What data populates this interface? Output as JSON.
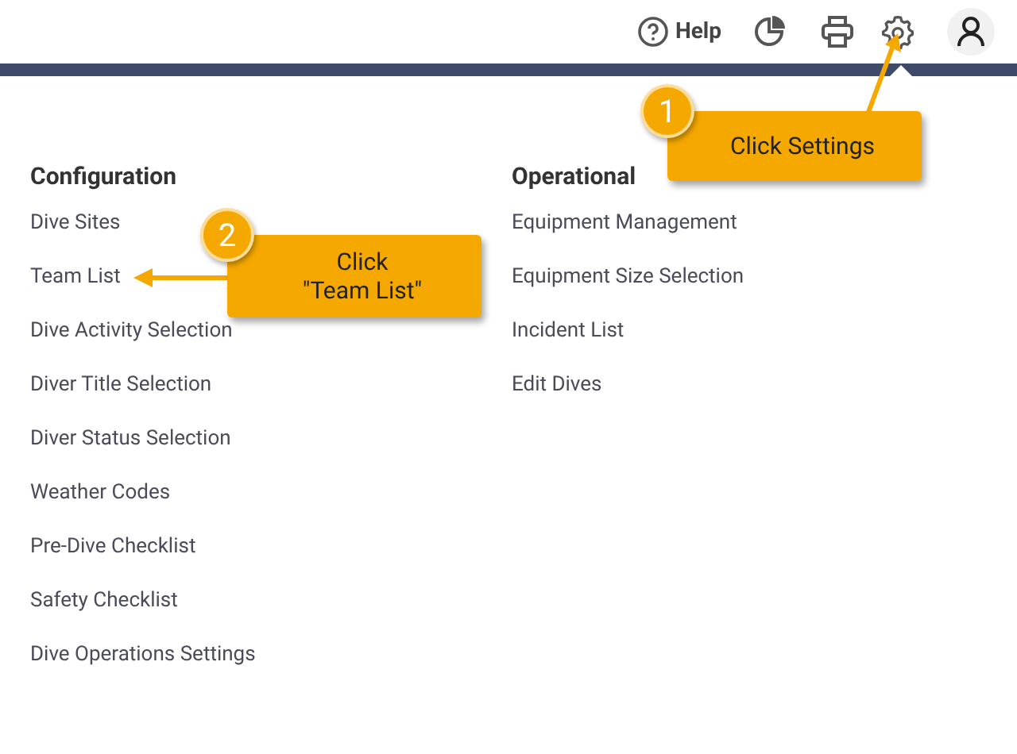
{
  "header": {
    "help_label": "Help"
  },
  "columns": [
    {
      "heading": "Configuration",
      "items": [
        "Dive Sites",
        "Team List",
        "Dive Activity Selection",
        "Diver Title Selection",
        "Diver Status Selection",
        "Weather Codes",
        "Pre-Dive Checklist",
        "Safety Checklist",
        "Dive Operations Settings"
      ]
    },
    {
      "heading": "Operational",
      "items": [
        "Equipment Management",
        "Equipment Size Selection",
        "Incident List",
        "Edit Dives"
      ]
    }
  ],
  "callouts": [
    {
      "number": "1",
      "text": "Click Settings"
    },
    {
      "number": "2",
      "text": "Click\n\"Team List\""
    }
  ]
}
